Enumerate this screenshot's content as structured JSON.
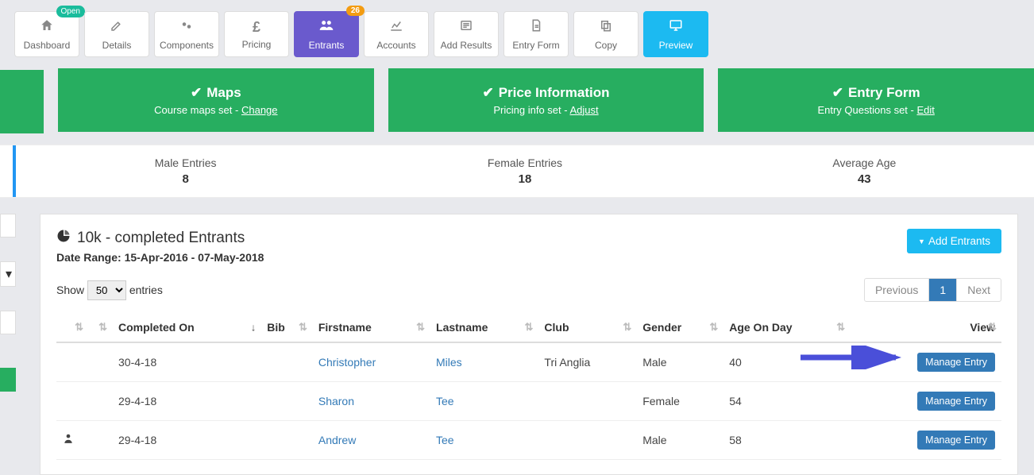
{
  "nav": {
    "dashboard": {
      "label": "Dashboard",
      "badge": "Open"
    },
    "details": {
      "label": "Details"
    },
    "components": {
      "label": "Components"
    },
    "pricing": {
      "label": "Pricing"
    },
    "entrants": {
      "label": "Entrants",
      "badge": "26"
    },
    "accounts": {
      "label": "Accounts"
    },
    "add_results": {
      "label": "Add Results"
    },
    "entry_form": {
      "label": "Entry Form"
    },
    "copy": {
      "label": "Copy"
    },
    "preview": {
      "label": "Preview"
    }
  },
  "panels": {
    "maps": {
      "title": "Maps",
      "sub_prefix": "Course maps set - ",
      "link": "Change"
    },
    "price": {
      "title": "Price Information",
      "sub_prefix": "Pricing info set - ",
      "link": "Adjust"
    },
    "entry": {
      "title": "Entry Form",
      "sub_prefix": "Entry Questions set - ",
      "link": "Edit"
    }
  },
  "stats": {
    "male": {
      "label": "Male Entries",
      "value": "8"
    },
    "female": {
      "label": "Female Entries",
      "value": "18"
    },
    "age": {
      "label": "Average Age",
      "value": "43"
    }
  },
  "card": {
    "title": "10k - completed Entrants",
    "date_range": "Date Range: 15-Apr-2016 - 07-May-2018",
    "add_button": "Add Entrants"
  },
  "table": {
    "show_label_pre": "Show",
    "show_label_post": "entries",
    "page_size": "50",
    "pager_prev": "Previous",
    "pager_page": "1",
    "pager_next": "Next",
    "cols": {
      "completed": "Completed On",
      "bib": "Bib",
      "first": "Firstname",
      "last": "Lastname",
      "club": "Club",
      "gender": "Gender",
      "age": "Age On Day",
      "view": "View"
    },
    "manage_label": "Manage Entry",
    "rows": [
      {
        "icon": "",
        "completed": "30-4-18",
        "bib": "",
        "first": "Christopher",
        "last": "Miles",
        "club": "Tri Anglia",
        "gender": "Male",
        "age": "40"
      },
      {
        "icon": "",
        "completed": "29-4-18",
        "bib": "",
        "first": "Sharon",
        "last": "Tee",
        "club": "",
        "gender": "Female",
        "age": "54"
      },
      {
        "icon": "user",
        "completed": "29-4-18",
        "bib": "",
        "first": "Andrew",
        "last": "Tee",
        "club": "",
        "gender": "Male",
        "age": "58"
      }
    ]
  }
}
